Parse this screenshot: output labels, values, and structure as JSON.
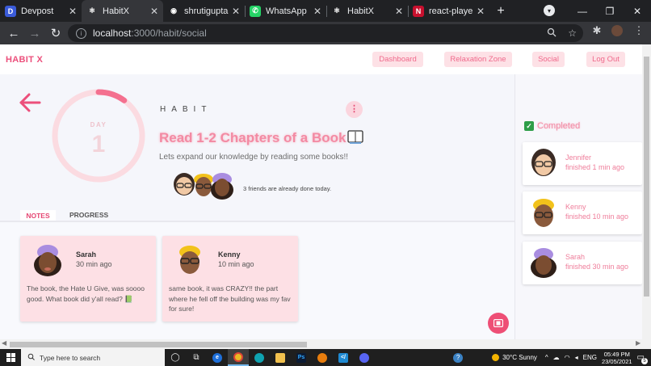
{
  "browser": {
    "tabs": [
      {
        "label": "Devpost",
        "favicon_letter": "D",
        "favicon_color": "#3a5bd9",
        "active": false
      },
      {
        "label": "HabitX",
        "favicon_letter": "⚛",
        "favicon_color": "#35363a",
        "active": true
      },
      {
        "label": "shrutigupta",
        "favicon_letter": "◉",
        "favicon_color": "#202124",
        "active": false
      },
      {
        "label": "WhatsApp",
        "favicon_letter": "✆",
        "favicon_color": "#25d366",
        "active": false
      },
      {
        "label": "HabitX",
        "favicon_letter": "⚛",
        "favicon_color": "#202124",
        "active": false
      },
      {
        "label": "react-player",
        "favicon_letter": "N",
        "favicon_color": "#c8102e",
        "active": false
      }
    ],
    "url_host": "localhost",
    "url_path": ":3000/habit/social"
  },
  "nav": {
    "brand": "HABIT X",
    "links": [
      "Dashboard",
      "Relaxation Zone",
      "Social",
      "Log Out"
    ]
  },
  "habit": {
    "day_label": "DAY",
    "day_number": "1",
    "day_progress": 0.1,
    "kicker": "HABIT",
    "title": "Read 1-2 Chapters of a Book",
    "description": "Lets expand our knowledge by reading some books!!",
    "friends_done": "3 friends are already done today."
  },
  "tabs": {
    "notes": "NOTES",
    "progress": "PROGRESS"
  },
  "notes": [
    {
      "name": "Sarah",
      "time": "30 min ago",
      "text": "The book, the Hate U Give, was soooo good. What book did y'all read? 📗"
    },
    {
      "name": "Kenny",
      "time": "10 min ago",
      "text": "same book, it was CRAZY!! the part where he fell off the building was my fav for sure!"
    }
  ],
  "sidebar": {
    "heading": "Completed",
    "friends": [
      {
        "name": "Jennifer",
        "status": "finished 1 min ago"
      },
      {
        "name": "Kenny",
        "status": "finished 10 min ago"
      },
      {
        "name": "Sarah",
        "status": "finished 30 min ago"
      }
    ]
  },
  "taskbar": {
    "search_placeholder": "Type here to search",
    "weather": "30°C  Sunny",
    "language": "ENG",
    "time": "05:49 PM",
    "date": "23/05/2021",
    "notification_count": "5"
  },
  "colors": {
    "accent": "#ec4f7b",
    "accent_soft": "#fde1e6"
  }
}
